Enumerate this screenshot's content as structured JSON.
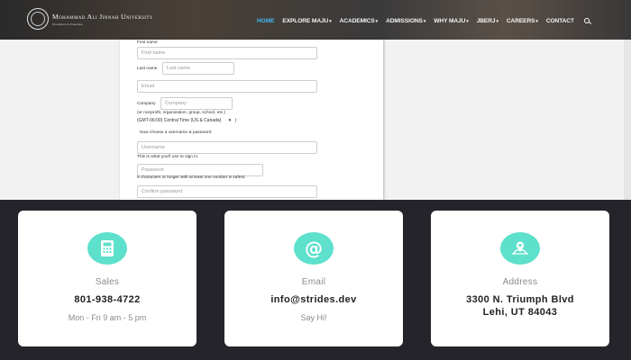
{
  "header": {
    "logo_name": "Mohammad Ali Jinnah University",
    "logo_sub": "Excellence in Education",
    "nav": [
      {
        "label": "HOME",
        "active": true,
        "caret": false
      },
      {
        "label": "EXPLORE MAJU",
        "active": false,
        "caret": true
      },
      {
        "label": "ACADEMICS",
        "active": false,
        "caret": true
      },
      {
        "label": "ADMISSIONS",
        "active": false,
        "caret": true
      },
      {
        "label": "WHY MAJU",
        "active": false,
        "caret": true
      },
      {
        "label": "JBERJ",
        "active": false,
        "caret": true
      },
      {
        "label": "CAREERS",
        "active": false,
        "caret": true
      },
      {
        "label": "CONTACT",
        "active": false,
        "caret": false
      }
    ]
  },
  "form": {
    "first_name_label": "First name",
    "first_name_placeholder": "First name",
    "last_name_label": "Last name",
    "last_name_placeholder": "Last name",
    "email_placeholder": "Email",
    "company_label": "Company",
    "company_placeholder": "Company",
    "company_hint": "(or nonprofit, organization, group, school, etc.)",
    "timezone_value": "(GMT-06:00) Central Time (US & Canada)",
    "credentials_heading": "Now choose a username & password",
    "username_placeholder": "Username",
    "username_hint": "This is what you'll use to sign in.",
    "password_placeholder": "Password",
    "password_hint": "8 characters or longer with at least one number is safest.",
    "confirm_placeholder": "Confirm password"
  },
  "cards": [
    {
      "title": "Sales",
      "value": "801-938-4722",
      "sub": "Mon - Fri 9 am - 5 pm",
      "icon": "calculator-icon"
    },
    {
      "title": "Email",
      "value": "info@strides.dev",
      "sub": "Say Hi!",
      "icon": "at-sign-icon"
    },
    {
      "title": "Address",
      "value_line1": "3300 N. Triumph Blvd",
      "value_line2": "Lehi, UT 84043",
      "icon": "map-pin-icon"
    }
  ],
  "colors": {
    "nav_active": "#44b6f2",
    "icon_bg": "#5de0cc",
    "dark_band": "#24242a"
  }
}
